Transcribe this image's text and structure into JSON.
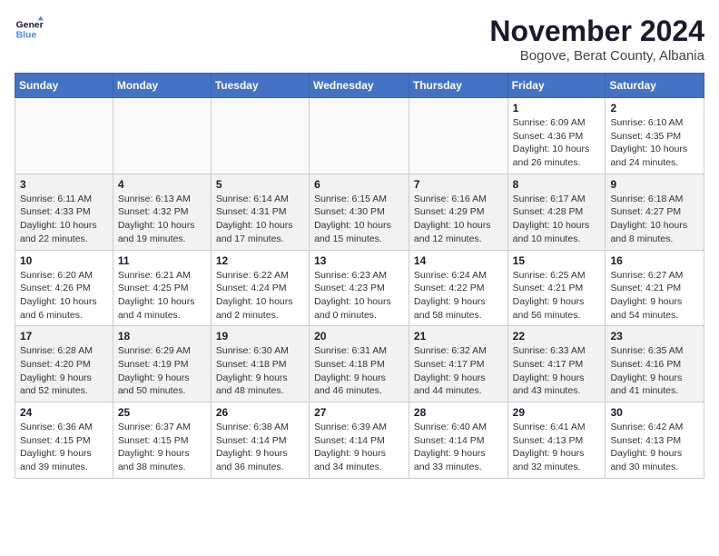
{
  "header": {
    "logo_line1": "General",
    "logo_line2": "Blue",
    "month_title": "November 2024",
    "location": "Bogove, Berat County, Albania"
  },
  "weekdays": [
    "Sunday",
    "Monday",
    "Tuesday",
    "Wednesday",
    "Thursday",
    "Friday",
    "Saturday"
  ],
  "weeks": [
    [
      {
        "day": "",
        "detail": ""
      },
      {
        "day": "",
        "detail": ""
      },
      {
        "day": "",
        "detail": ""
      },
      {
        "day": "",
        "detail": ""
      },
      {
        "day": "",
        "detail": ""
      },
      {
        "day": "1",
        "detail": "Sunrise: 6:09 AM\nSunset: 4:36 PM\nDaylight: 10 hours and 26 minutes."
      },
      {
        "day": "2",
        "detail": "Sunrise: 6:10 AM\nSunset: 4:35 PM\nDaylight: 10 hours and 24 minutes."
      }
    ],
    [
      {
        "day": "3",
        "detail": "Sunrise: 6:11 AM\nSunset: 4:33 PM\nDaylight: 10 hours and 22 minutes."
      },
      {
        "day": "4",
        "detail": "Sunrise: 6:13 AM\nSunset: 4:32 PM\nDaylight: 10 hours and 19 minutes."
      },
      {
        "day": "5",
        "detail": "Sunrise: 6:14 AM\nSunset: 4:31 PM\nDaylight: 10 hours and 17 minutes."
      },
      {
        "day": "6",
        "detail": "Sunrise: 6:15 AM\nSunset: 4:30 PM\nDaylight: 10 hours and 15 minutes."
      },
      {
        "day": "7",
        "detail": "Sunrise: 6:16 AM\nSunset: 4:29 PM\nDaylight: 10 hours and 12 minutes."
      },
      {
        "day": "8",
        "detail": "Sunrise: 6:17 AM\nSunset: 4:28 PM\nDaylight: 10 hours and 10 minutes."
      },
      {
        "day": "9",
        "detail": "Sunrise: 6:18 AM\nSunset: 4:27 PM\nDaylight: 10 hours and 8 minutes."
      }
    ],
    [
      {
        "day": "10",
        "detail": "Sunrise: 6:20 AM\nSunset: 4:26 PM\nDaylight: 10 hours and 6 minutes."
      },
      {
        "day": "11",
        "detail": "Sunrise: 6:21 AM\nSunset: 4:25 PM\nDaylight: 10 hours and 4 minutes."
      },
      {
        "day": "12",
        "detail": "Sunrise: 6:22 AM\nSunset: 4:24 PM\nDaylight: 10 hours and 2 minutes."
      },
      {
        "day": "13",
        "detail": "Sunrise: 6:23 AM\nSunset: 4:23 PM\nDaylight: 10 hours and 0 minutes."
      },
      {
        "day": "14",
        "detail": "Sunrise: 6:24 AM\nSunset: 4:22 PM\nDaylight: 9 hours and 58 minutes."
      },
      {
        "day": "15",
        "detail": "Sunrise: 6:25 AM\nSunset: 4:21 PM\nDaylight: 9 hours and 56 minutes."
      },
      {
        "day": "16",
        "detail": "Sunrise: 6:27 AM\nSunset: 4:21 PM\nDaylight: 9 hours and 54 minutes."
      }
    ],
    [
      {
        "day": "17",
        "detail": "Sunrise: 6:28 AM\nSunset: 4:20 PM\nDaylight: 9 hours and 52 minutes."
      },
      {
        "day": "18",
        "detail": "Sunrise: 6:29 AM\nSunset: 4:19 PM\nDaylight: 9 hours and 50 minutes."
      },
      {
        "day": "19",
        "detail": "Sunrise: 6:30 AM\nSunset: 4:18 PM\nDaylight: 9 hours and 48 minutes."
      },
      {
        "day": "20",
        "detail": "Sunrise: 6:31 AM\nSunset: 4:18 PM\nDaylight: 9 hours and 46 minutes."
      },
      {
        "day": "21",
        "detail": "Sunrise: 6:32 AM\nSunset: 4:17 PM\nDaylight: 9 hours and 44 minutes."
      },
      {
        "day": "22",
        "detail": "Sunrise: 6:33 AM\nSunset: 4:17 PM\nDaylight: 9 hours and 43 minutes."
      },
      {
        "day": "23",
        "detail": "Sunrise: 6:35 AM\nSunset: 4:16 PM\nDaylight: 9 hours and 41 minutes."
      }
    ],
    [
      {
        "day": "24",
        "detail": "Sunrise: 6:36 AM\nSunset: 4:15 PM\nDaylight: 9 hours and 39 minutes."
      },
      {
        "day": "25",
        "detail": "Sunrise: 6:37 AM\nSunset: 4:15 PM\nDaylight: 9 hours and 38 minutes."
      },
      {
        "day": "26",
        "detail": "Sunrise: 6:38 AM\nSunset: 4:14 PM\nDaylight: 9 hours and 36 minutes."
      },
      {
        "day": "27",
        "detail": "Sunrise: 6:39 AM\nSunset: 4:14 PM\nDaylight: 9 hours and 34 minutes."
      },
      {
        "day": "28",
        "detail": "Sunrise: 6:40 AM\nSunset: 4:14 PM\nDaylight: 9 hours and 33 minutes."
      },
      {
        "day": "29",
        "detail": "Sunrise: 6:41 AM\nSunset: 4:13 PM\nDaylight: 9 hours and 32 minutes."
      },
      {
        "day": "30",
        "detail": "Sunrise: 6:42 AM\nSunset: 4:13 PM\nDaylight: 9 hours and 30 minutes."
      }
    ]
  ]
}
